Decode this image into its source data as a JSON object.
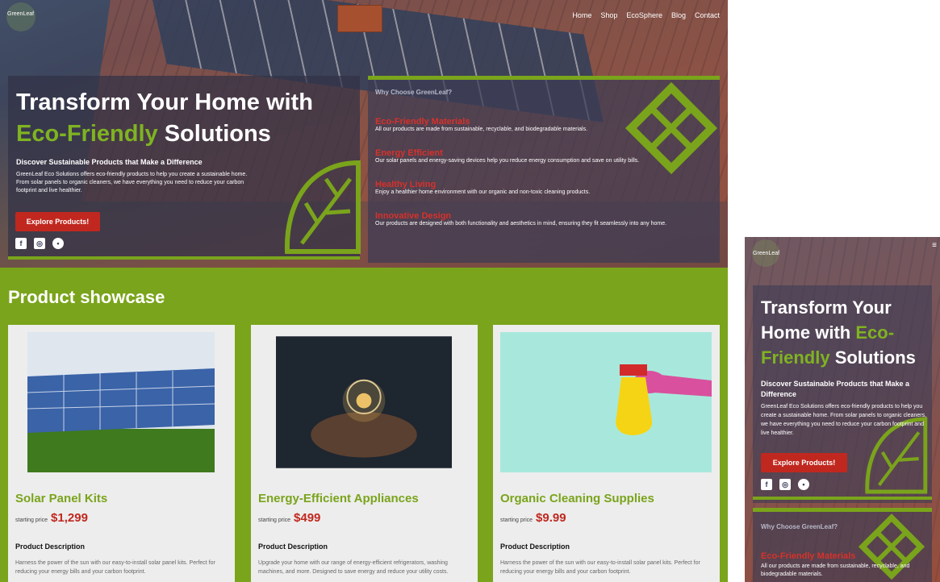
{
  "brand": "GreenLeaf",
  "nav": [
    "Home",
    "Shop",
    "EcoSphere",
    "Blog",
    "Contact"
  ],
  "hero": {
    "title_part1": "Transform Your Home with ",
    "title_green": "Eco-Friendly",
    "title_part2": " Solutions",
    "subheading": "Discover Sustainable Products that Make a Difference",
    "description": "GreenLeaf Eco Solutions offers eco-friendly products to help you create a sustainable home. From solar panels to organic cleaners, we have everything you need to reduce your carbon footprint and live healthier.",
    "cta": "Explore Products!",
    "social": [
      {
        "icon": "facebook-icon",
        "glyph": "f"
      },
      {
        "icon": "instagram-icon",
        "glyph": "◎"
      },
      {
        "icon": "line-icon",
        "glyph": "•"
      }
    ]
  },
  "why": {
    "heading": "Why Choose GreenLeaf?",
    "features": [
      {
        "title": "Eco-Friendly Materials",
        "desc": "All our products are made from sustainable, recyclable, and biodegradable materials."
      },
      {
        "title": "Energy Efficient",
        "desc": "Our solar panels and energy-saving devices help you reduce energy consumption and save on utility bills."
      },
      {
        "title": "Healthy Living",
        "desc": "Enjoy a healthier home environment with our organic and non-toxic cleaning products."
      },
      {
        "title": "Innovative Design",
        "desc": "Our products are designed with both functionality and aesthetics in mind, ensuring they fit seamlessly into any home."
      }
    ]
  },
  "showcase": {
    "heading": "Product showcase",
    "products": [
      {
        "title": "Solar Panel Kits",
        "price_label": "starting price",
        "price": "$1,299",
        "desc_heading": "Product Description",
        "desc": "Harness the power of the sun with our easy-to-install solar panel kits. Perfect for reducing your energy bills and your carbon footprint."
      },
      {
        "title": "Energy-Efficient Appliances",
        "price_label": "starting price",
        "price": "$499",
        "desc_heading": "Product Description",
        "desc": "Upgrade your home with our range of energy-efficient refrigerators, washing machines, and more. Designed to save energy and reduce your utility costs."
      },
      {
        "title": "Organic Cleaning Supplies",
        "price_label": "starting price",
        "price": "$9.99",
        "desc_heading": "Product Description",
        "desc": "Harness the power of the sun with our easy-to-install solar panel kits. Perfect for reducing your energy bills and your carbon footprint."
      }
    ]
  },
  "mobile": {
    "menu_icon": "≡"
  },
  "colors": {
    "accent_green": "#7aa41b",
    "cta_red": "#c0281f",
    "feature_red": "#d8312a"
  }
}
